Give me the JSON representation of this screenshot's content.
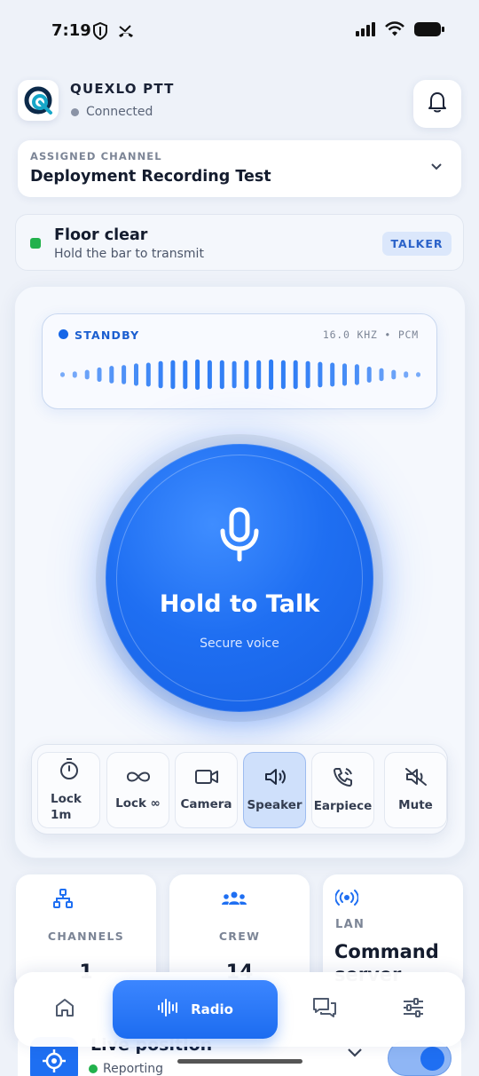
{
  "status_bar": {
    "time": "7:19",
    "left_icons": [
      "shield-icon",
      "missed-call-icon"
    ],
    "right_icons": [
      "signal-icon",
      "wifi-icon",
      "battery-icon"
    ]
  },
  "header": {
    "app_name": "QUEXLO PTT",
    "connection_status": "Connected",
    "logo_icon": "quexlo-logo-icon",
    "bell_icon": "bell-icon"
  },
  "channel": {
    "caption": "ASSIGNED CHANNEL",
    "name": "Deployment Recording Test"
  },
  "floor": {
    "title": "Floor clear",
    "subtitle": "Hold the bar to transmit",
    "badge": "TALKER",
    "status_color": "#22b14c"
  },
  "waveform": {
    "state": "STANDBY",
    "format": "16.0 KHZ • PCM",
    "bars": [
      0.15,
      0.2,
      0.3,
      0.45,
      0.55,
      0.6,
      0.7,
      0.75,
      0.85,
      0.9,
      0.9,
      0.95,
      0.9,
      0.9,
      0.85,
      0.9,
      0.9,
      0.95,
      0.9,
      0.9,
      0.85,
      0.8,
      0.75,
      0.7,
      0.65,
      0.5,
      0.4,
      0.3,
      0.2,
      0.15
    ]
  },
  "ptt": {
    "label": "Hold to Talk",
    "subtitle": "Secure voice",
    "icon": "microphone-icon",
    "accent": "#1f6ff2"
  },
  "controls": [
    {
      "label": "Lock 1m",
      "icon": "timer-icon",
      "active": false
    },
    {
      "label": "Lock ∞",
      "icon": "infinity-icon",
      "active": false
    },
    {
      "label": "Camera",
      "icon": "camera-icon",
      "active": false
    },
    {
      "label": "Speaker",
      "icon": "speaker-icon",
      "active": true
    },
    {
      "label": "Earpiece",
      "icon": "earpiece-icon",
      "active": false
    },
    {
      "label": "Mute",
      "icon": "mute-icon",
      "active": false
    }
  ],
  "stats": [
    {
      "caption": "CHANNELS",
      "value": "1",
      "icon": "channels-icon"
    },
    {
      "caption": "CREW",
      "value": "14",
      "icon": "crew-icon"
    },
    {
      "caption": "LAN",
      "value": "Command server",
      "icon": "broadcast-icon"
    }
  ],
  "live_position": {
    "title": "Live position",
    "subtitle": "Reporting",
    "enabled": true
  },
  "nav": {
    "items": [
      {
        "label": "",
        "icon": "home-icon"
      },
      {
        "label": "Radio",
        "icon": "radio-wave-icon"
      },
      {
        "label": "",
        "icon": "chat-icon"
      },
      {
        "label": "",
        "icon": "sliders-icon"
      }
    ]
  }
}
